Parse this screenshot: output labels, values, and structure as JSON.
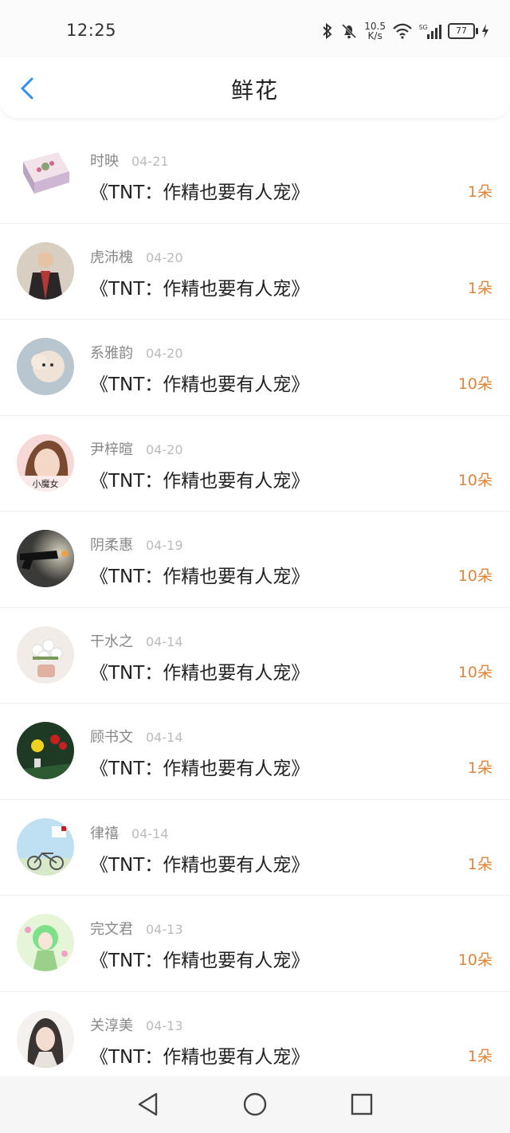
{
  "status": {
    "time": "12:25",
    "netspeed_value": "10.5",
    "netspeed_unit": "K/s",
    "network": "5G",
    "battery": "77"
  },
  "header": {
    "title": "鲜花"
  },
  "items": [
    {
      "name": "时映",
      "date": "04-21",
      "book": "《TNT：作精也要有人宠》",
      "count": "1朵"
    },
    {
      "name": "虎沛槐",
      "date": "04-20",
      "book": "《TNT：作精也要有人宠》",
      "count": "1朵"
    },
    {
      "name": "系雅韵",
      "date": "04-20",
      "book": "《TNT：作精也要有人宠》",
      "count": "10朵"
    },
    {
      "name": "尹梓暄",
      "date": "04-20",
      "book": "《TNT：作精也要有人宠》",
      "count": "10朵",
      "avatar_caption": "小魔女"
    },
    {
      "name": "阴柔惠",
      "date": "04-19",
      "book": "《TNT：作精也要有人宠》",
      "count": "10朵"
    },
    {
      "name": "干水之",
      "date": "04-14",
      "book": "《TNT：作精也要有人宠》",
      "count": "10朵"
    },
    {
      "name": "顾书文",
      "date": "04-14",
      "book": "《TNT：作精也要有人宠》",
      "count": "1朵"
    },
    {
      "name": "律禧",
      "date": "04-14",
      "book": "《TNT：作精也要有人宠》",
      "count": "1朵"
    },
    {
      "name": "完文君",
      "date": "04-13",
      "book": "《TNT：作精也要有人宠》",
      "count": "10朵"
    },
    {
      "name": "关淳美",
      "date": "04-13",
      "book": "《TNT：作精也要有人宠》",
      "count": "1朵"
    }
  ],
  "colors": {
    "accent_blue": "#2f8ff0",
    "count_orange": "#e0843a"
  }
}
